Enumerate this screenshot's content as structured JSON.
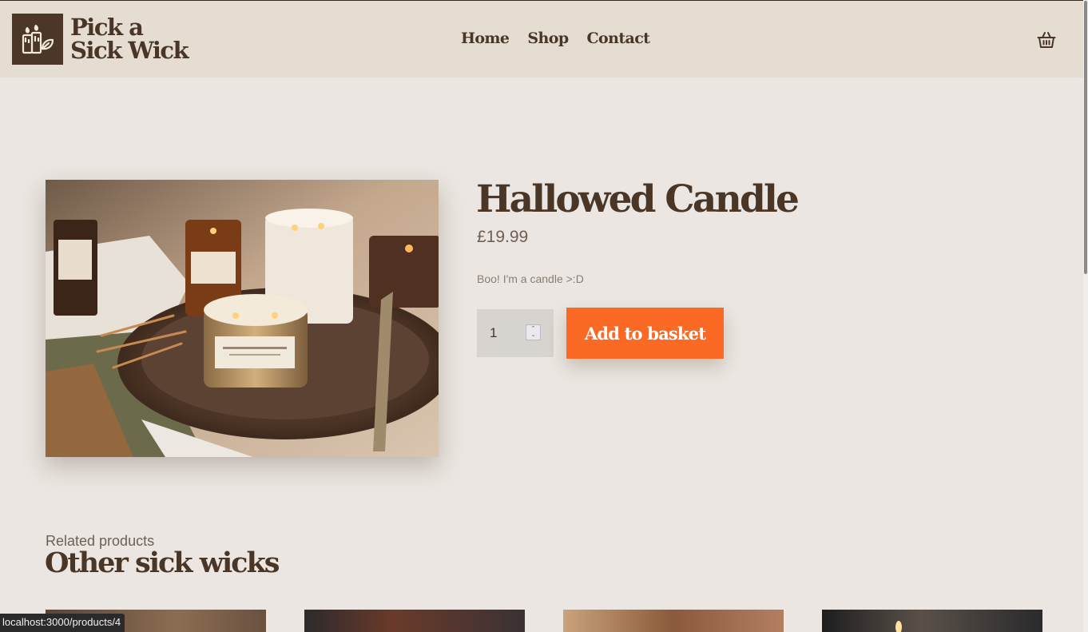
{
  "brand": {
    "line1": "Pick a",
    "line2": "Sick Wick",
    "logo_icon": "candles-leaf-icon",
    "color": "#4b3627"
  },
  "nav": {
    "items": [
      {
        "label": "Home"
      },
      {
        "label": "Shop"
      },
      {
        "label": "Contact"
      }
    ],
    "cart_icon": "basket-icon"
  },
  "product": {
    "title": "Hallowed Candle",
    "price": "£19.99",
    "description": "Boo! I'm a candle >:D",
    "quantity": "1",
    "add_to_basket_label": "Add to basket",
    "image_icon": "candle-photo",
    "accent": "#fb6a25"
  },
  "related": {
    "subtitle": "Related products",
    "title": "Other sick wicks"
  },
  "status_bar": {
    "url": "localhost:3000/products/4"
  }
}
